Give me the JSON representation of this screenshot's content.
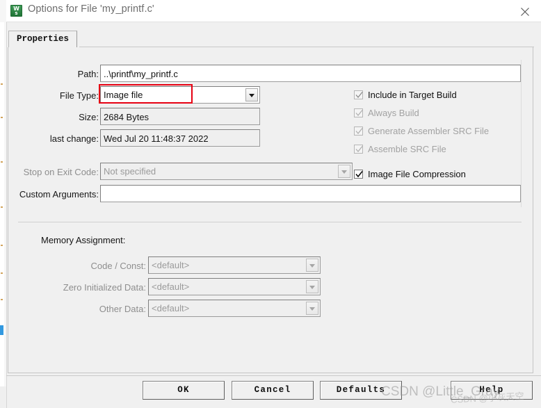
{
  "window": {
    "title": "Options for File 'my_printf.c'",
    "icon_name": "iar-embedded-workbench-icon",
    "icon_glyph_top": "W",
    "icon_glyph_bottom": "s",
    "close_label": "✕"
  },
  "tabs": [
    {
      "label": "Properties",
      "active": true
    }
  ],
  "form": {
    "path": {
      "label": "Path:",
      "value": "..\\printf\\my_printf.c"
    },
    "file_type": {
      "label": "File Type:",
      "value": "Image file",
      "options": [
        "Image file"
      ]
    },
    "size": {
      "label": "Size:",
      "value": "2684 Bytes"
    },
    "last_change": {
      "label": "last change:",
      "value": "Wed Jul 20 11:48:37 2022"
    },
    "stop_on_exit_code": {
      "label": "Stop on Exit Code:",
      "value": "Not specified",
      "options": [
        "Not specified"
      ]
    },
    "custom_arguments": {
      "label": "Custom Arguments:",
      "value": ""
    }
  },
  "checkboxes": [
    {
      "label": "Include in Target Build",
      "checked": true,
      "enabled": true
    },
    {
      "label": "Always Build",
      "checked": true,
      "enabled": false
    },
    {
      "label": "Generate Assembler SRC File",
      "checked": true,
      "enabled": false
    },
    {
      "label": "Assemble SRC File",
      "checked": true,
      "enabled": false
    },
    {
      "label": "Image File Compression",
      "checked": true,
      "enabled": true
    }
  ],
  "memory_assignment": {
    "title": "Memory Assignment:",
    "rows": [
      {
        "label": "Code / Const:",
        "value": "<default>",
        "enabled": false
      },
      {
        "label": "Zero Initialized Data:",
        "value": "<default>",
        "enabled": false
      },
      {
        "label": "Other Data:",
        "value": "<default>",
        "enabled": false
      }
    ]
  },
  "footer": {
    "buttons": [
      {
        "label": "OK"
      },
      {
        "label": "Cancel"
      },
      {
        "label": "Defaults"
      },
      {
        "label": "Help"
      }
    ]
  },
  "annotations": {
    "highlight_color": "#e60012",
    "highlight_target": "file-type-field"
  },
  "watermarks": [
    {
      "text": "CSDN @Little_Gray"
    },
    {
      "text": "CSDN @小灰天空"
    }
  ]
}
